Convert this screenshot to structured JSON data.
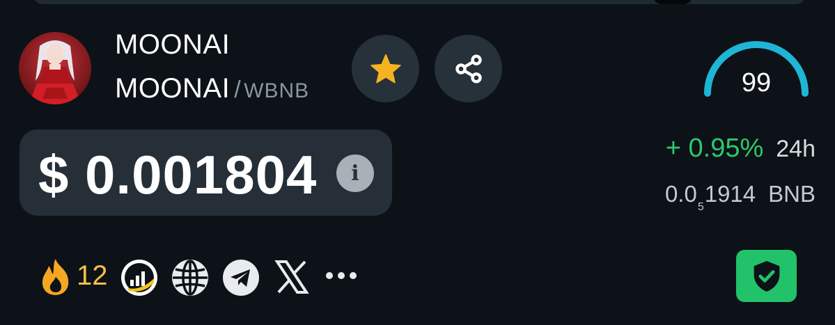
{
  "token": {
    "name": "MOONAI",
    "base": "MOONAI",
    "separator": "/",
    "quote": "WBNB",
    "avatar_icon": "anime-avatar"
  },
  "actions": {
    "favorite_icon": "star-icon",
    "share_icon": "share-icon",
    "accent_star": "#f5b322"
  },
  "score": {
    "value": "99",
    "gauge_level": 0.99,
    "color": "#1fb5d6"
  },
  "price": {
    "usd": "$ 0.001804",
    "info_glyph": "i"
  },
  "change": {
    "pct": "+ 0.95%",
    "period": "24h",
    "color": "#2ec86b"
  },
  "bnb_price": {
    "prefix": "0.0",
    "zeros": "5",
    "digits": "1914",
    "unit": "BNB"
  },
  "socials": {
    "hot_count": "12",
    "icons": [
      "fire-icon",
      "chart-logo-icon",
      "globe-icon",
      "telegram-icon",
      "x-icon",
      "more-icon"
    ]
  },
  "security": {
    "icon": "shield-check-icon",
    "color": "#22c26a"
  }
}
